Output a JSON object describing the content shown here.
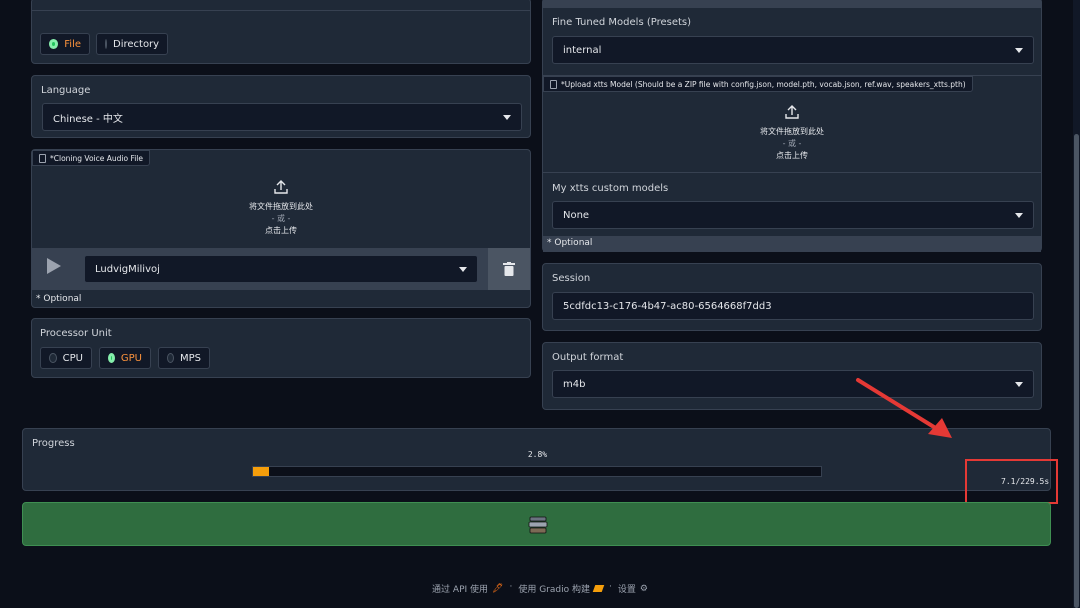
{
  "source": {
    "options": [
      "File",
      "Directory"
    ],
    "selected": "File"
  },
  "language": {
    "label": "Language",
    "value": "Chinese - 中文"
  },
  "voice_upload": {
    "tag": "*Cloning Voice Audio File",
    "drop_text": "将文件拖放到此处",
    "or_text": "- 或 -",
    "click_text": "点击上传",
    "voice_value": "LudvigMilivoj",
    "optional": "* Optional"
  },
  "processor": {
    "label": "Processor Unit",
    "options": [
      "CPU",
      "GPU",
      "MPS"
    ],
    "selected": "GPU"
  },
  "fine_tuned": {
    "label": "Fine Tuned Models (Presets)",
    "value": "internal"
  },
  "xtts_upload": {
    "tag": "*Upload xtts Model (Should be a ZIP file with config.json, model.pth, vocab.json, ref.wav, speakers_xtts.pth)",
    "drop_text": "将文件拖放到此处",
    "or_text": "- 或 -",
    "click_text": "点击上传"
  },
  "custom_models": {
    "label": "My xtts custom models",
    "value": "None",
    "optional": "* Optional"
  },
  "session": {
    "label": "Session",
    "value": "5cdfdc13-c176-4b47-ac80-6564668f7dd3"
  },
  "output_format": {
    "label": "Output format",
    "value": "m4b"
  },
  "progress": {
    "label": "Progress",
    "percent_text": "2.8%",
    "fraction": 0.028,
    "timer": "7.1/229.5s"
  },
  "convert_button": {
    "icon": "books-icon"
  },
  "footer": {
    "api": "通过 API 使用",
    "sep": "·",
    "gradio": "使用 Gradio 构建",
    "settings": "设置"
  },
  "colors": {
    "bg": "#0b0f19",
    "panel": "#1f2937",
    "accent": "#f59e0b",
    "radio_on": "#22c55e",
    "button": "#2f6d3f",
    "annotation": "#e53935"
  }
}
